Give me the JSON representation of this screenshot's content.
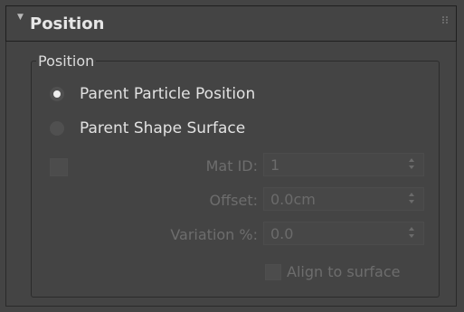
{
  "rollout": {
    "title": "Position",
    "collapse_icon": "triangle-down",
    "grip_icon": "grip-dots"
  },
  "group": {
    "label": "Position"
  },
  "radios": [
    {
      "label": "Parent Particle Position",
      "checked": true
    },
    {
      "label": "Parent Shape Surface",
      "checked": false
    }
  ],
  "fields": {
    "mat_id": {
      "label": "Mat ID:",
      "value": "1",
      "enabled": false
    },
    "offset": {
      "label": "Offset:",
      "value": "0.0cm",
      "enabled": false
    },
    "variation": {
      "label": "Variation %:",
      "value": "0.0",
      "enabled": false
    }
  },
  "align_to_surface": {
    "label": "Align to surface",
    "checked": false,
    "enabled": false
  },
  "colors": {
    "background": "#444444",
    "text": "#dcdcdc",
    "disabled_text": "#6d6d6d"
  }
}
